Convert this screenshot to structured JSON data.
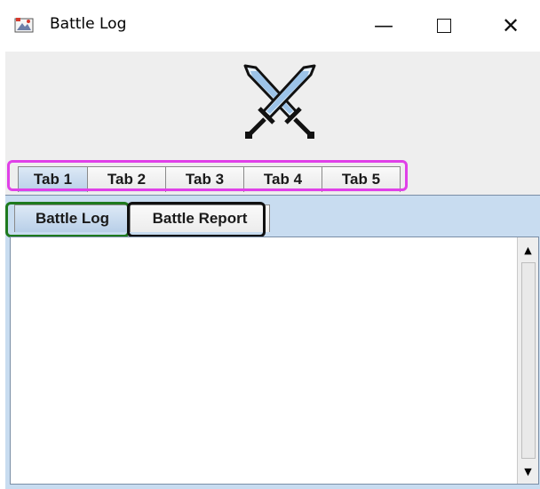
{
  "window": {
    "title": "Battle Log",
    "icons": {
      "app": "app-icon",
      "minimize": "minimize-icon",
      "maximize": "maximize-icon",
      "close": "close-icon"
    },
    "controls": {
      "minimize": "—",
      "close": "✕"
    }
  },
  "banner": {
    "icon": "crossed-swords-icon"
  },
  "outer_tabs": {
    "items": [
      "Tab 1",
      "Tab 2",
      "Tab 3",
      "Tab 4",
      "Tab 5"
    ],
    "selected": "Tab 1",
    "highlight_color": "#e040e8"
  },
  "inner_tabs": {
    "items": [
      "Battle Log",
      "Battle Report"
    ],
    "selected": "Battle Log",
    "highlight_colors": [
      "#1e7a1e",
      "#111111"
    ]
  },
  "log_area": {
    "content": ""
  },
  "scrollbar": {
    "up": "▲",
    "down": "▼"
  },
  "colors": {
    "selected_tab": "#c9dbef",
    "panel": "#c8dcf0",
    "banner": "#eeeeee"
  }
}
